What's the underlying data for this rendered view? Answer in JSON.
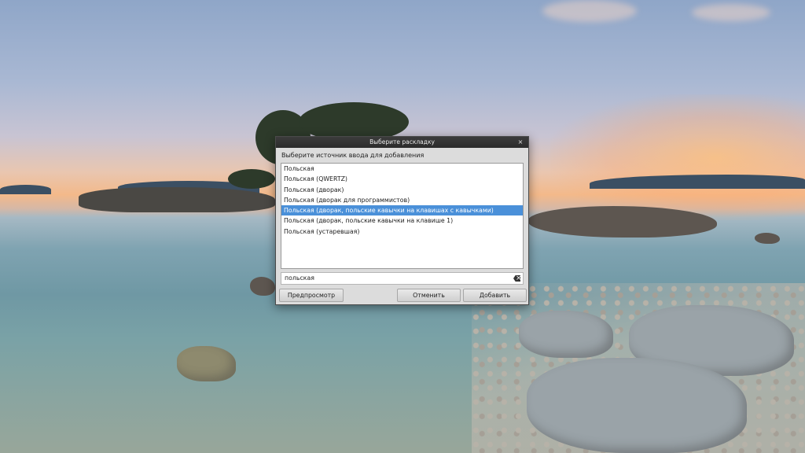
{
  "dialog": {
    "title": "Выберите раскладку",
    "close_glyph": "×",
    "prompt": "Выберите источник ввода для добавления",
    "items": [
      {
        "label": "Польская"
      },
      {
        "label": "Польская (QWERTZ)"
      },
      {
        "label": "Польская (дворак)"
      },
      {
        "label": "Польская (дворак для программистов)"
      },
      {
        "label": "Польская (дворак, польские кавычки на клавишах с кавычками)"
      },
      {
        "label": "Польская (дворак, польские кавычки на клавише 1)"
      },
      {
        "label": "Польская (устаревшая)"
      }
    ],
    "selected_index": 4,
    "search_value": "польская",
    "buttons": {
      "preview": "Предпросмотр",
      "cancel": "Отменить",
      "add": "Добавить"
    }
  },
  "colors": {
    "selection": "#4a90d9",
    "titlebar": "#2f2f2f",
    "dialog_bg": "#dcdcdc"
  }
}
